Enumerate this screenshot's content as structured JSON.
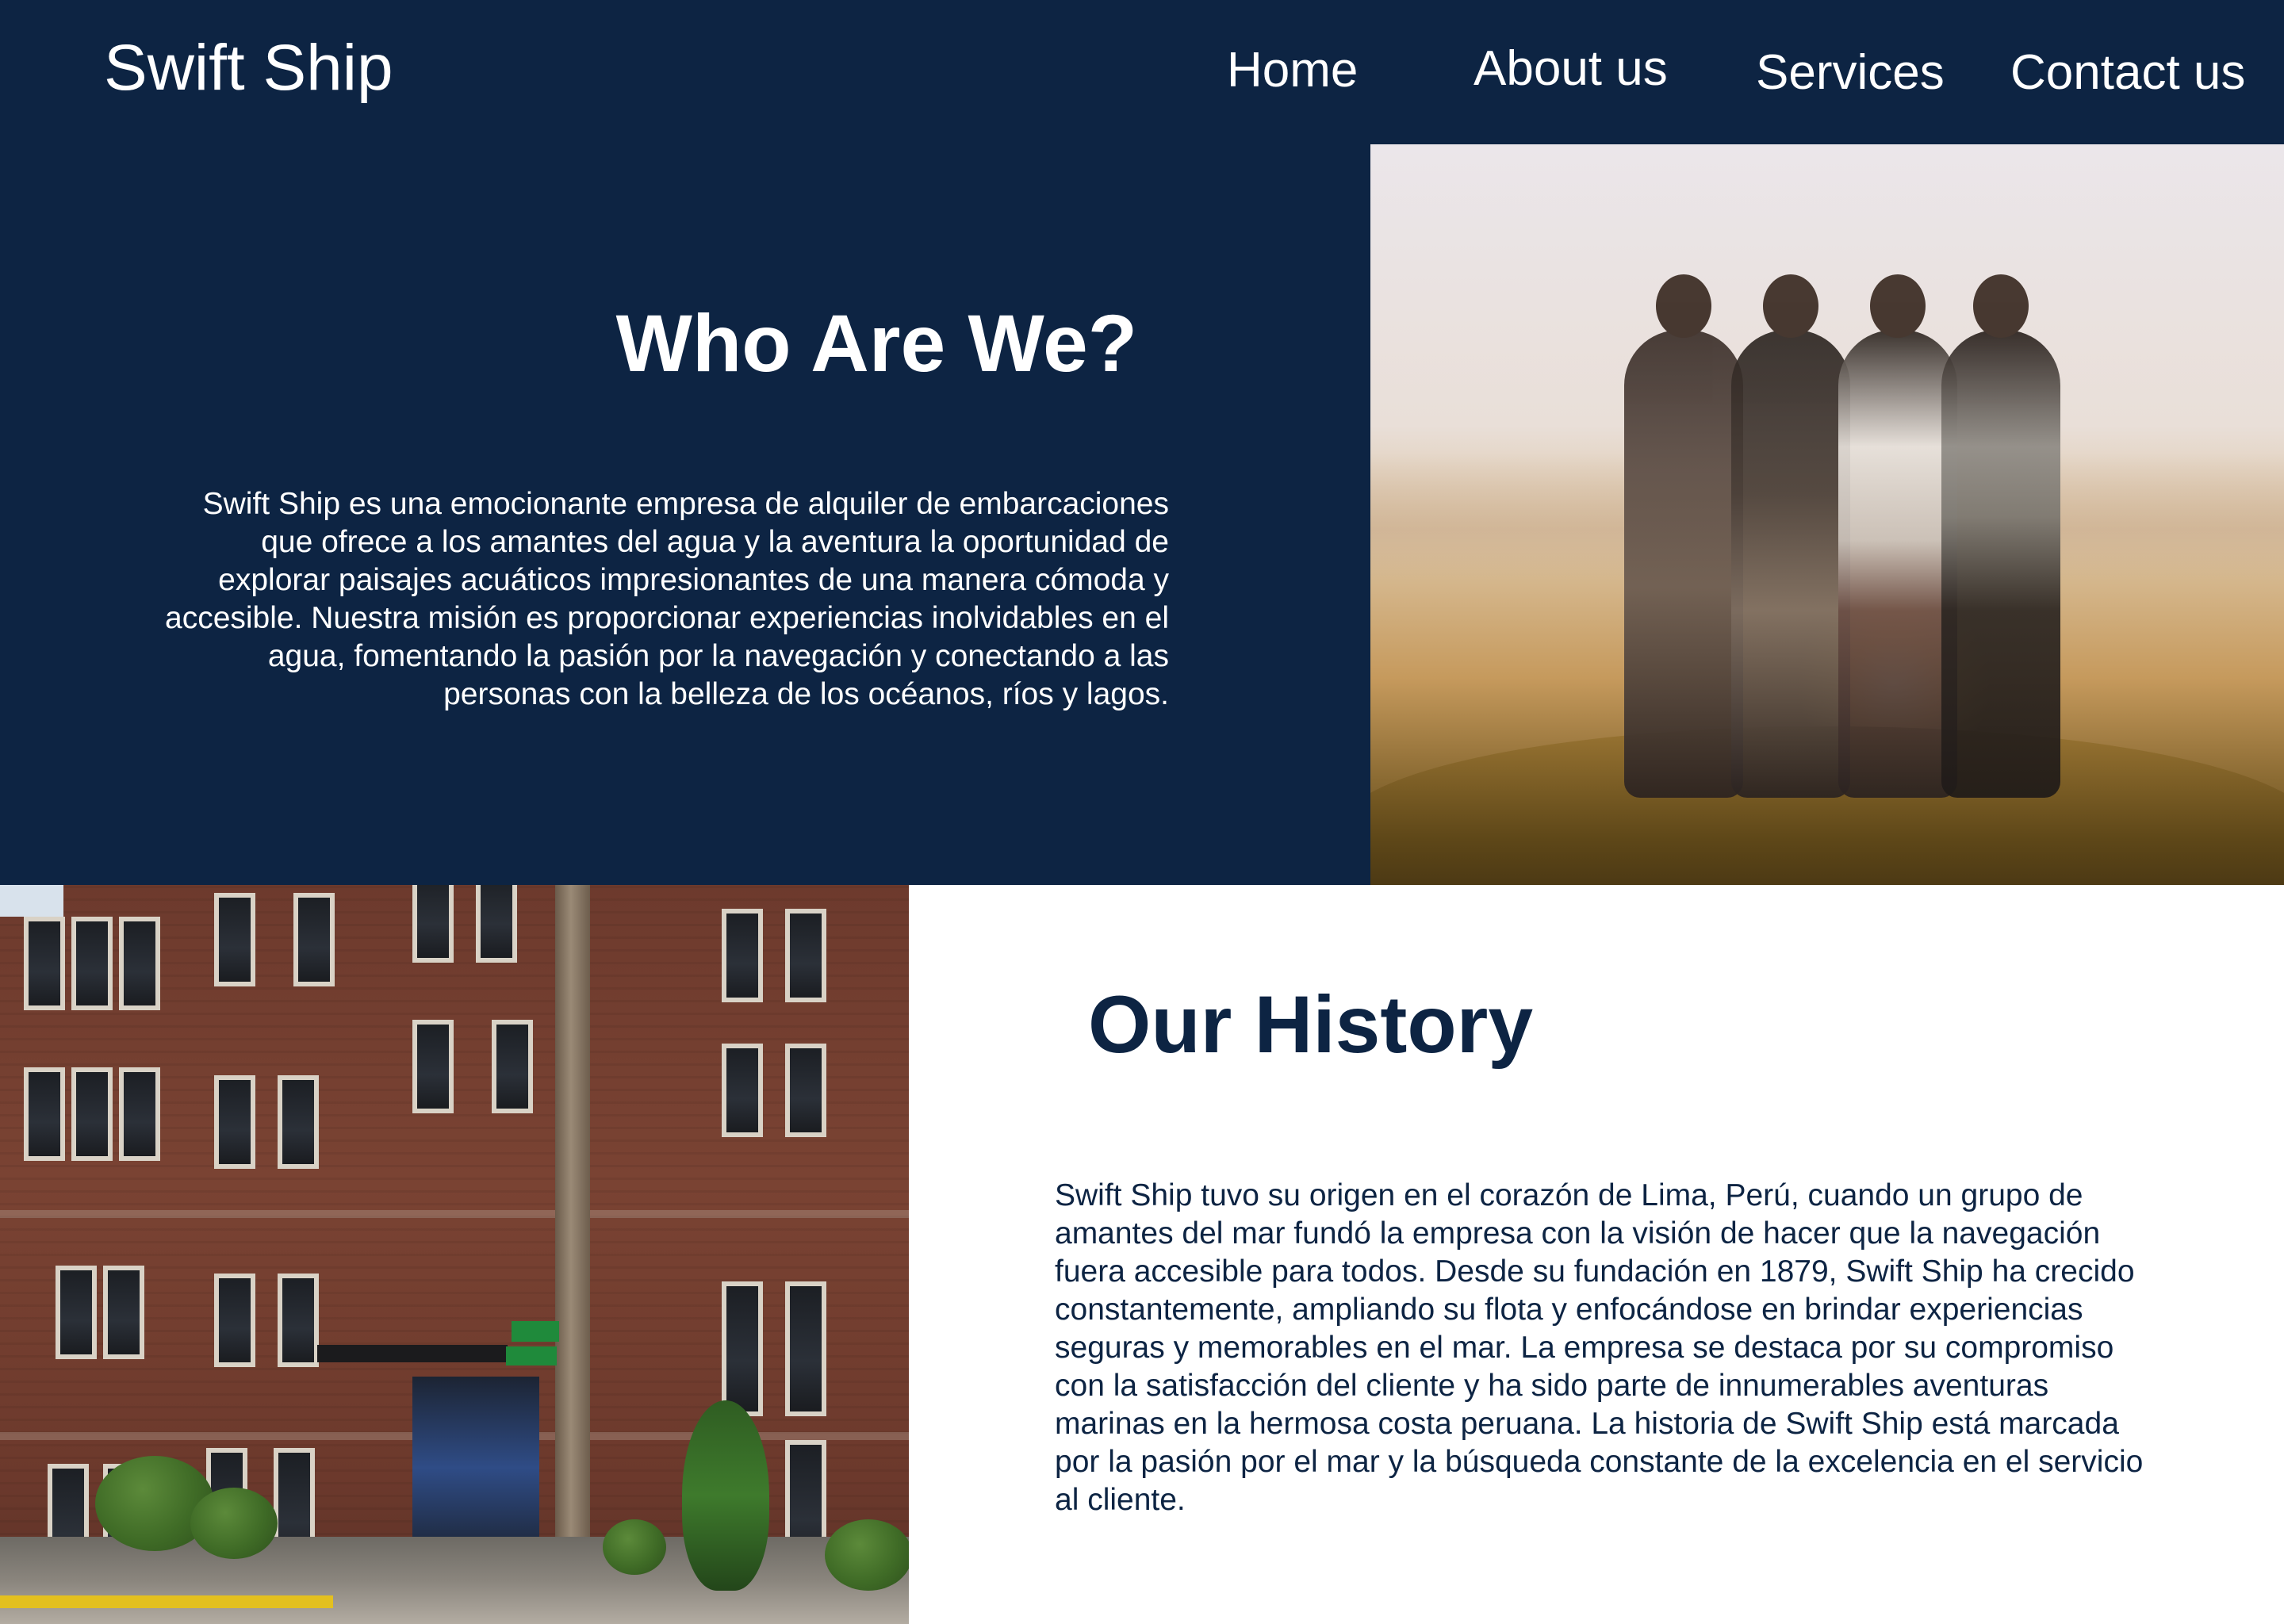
{
  "header": {
    "brand": "Swift Ship",
    "nav": {
      "home": "Home",
      "about": "About us",
      "services": "Services",
      "contact": "Contact us"
    }
  },
  "who": {
    "title": "Who Are We?",
    "text": "Swift Ship es una emocionante empresa de alquiler de embarcaciones que ofrece a los amantes del agua y la aventura la oportunidad de explorar paisajes acuáticos impresionantes de una manera cómoda y accesible. Nuestra misión es proporcionar experiencias inolvidables en el agua, fomentando la pasión por la navegación y conectando a las personas con la belleza de los océanos, ríos y lagos."
  },
  "history": {
    "title": "Our History",
    "text": "Swift Ship tuvo su origen en el corazón de Lima, Perú, cuando un grupo de amantes del mar fundó la empresa con la visión de hacer que la navegación fuera accesible para todos. Desde su fundación en 1879, Swift Ship ha crecido constantemente, ampliando su flota y enfocándose en brindar experiencias seguras y memorables en el mar. La empresa se destaca por su compromiso con la satisfacción del cliente y ha sido parte de innumerables aventuras marinas en la hermosa costa peruana. La historia de Swift Ship está marcada por la pasión por el mar y la búsqueda constante de la excelencia en el servicio al cliente."
  },
  "colors": {
    "navy": "#0d2443",
    "white": "#ffffff"
  }
}
